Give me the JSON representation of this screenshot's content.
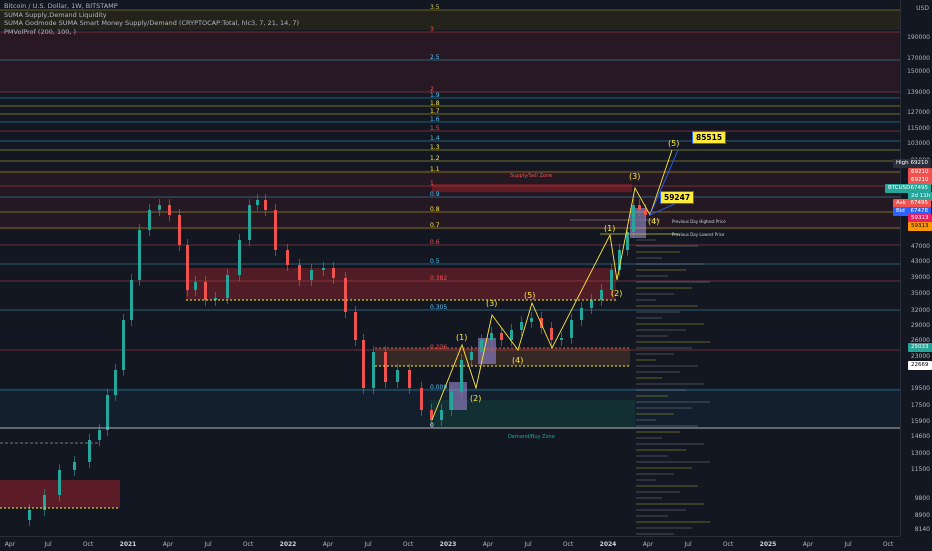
{
  "legend": {
    "symbol": "Bitcoin / U.S. Dollar, 1W, BITSTAMP",
    "indicator_1": "SUMA Supply,Demand Liquidity",
    "indicator_2": "SUMA Godmode SUMA Smart Money Supply/Demand (CRYPTOCAP:Total, hlc3, 7, 21, 14, 7)",
    "indicator_3": "PMVolProf (200, 100, )"
  },
  "price_axis": {
    "currency": "USD",
    "labels": [
      "190000",
      "170000",
      "150000",
      "139000",
      "127000",
      "115000",
      "103000",
      "91000",
      "81000",
      "47000",
      "43000",
      "39000",
      "35000",
      "32000",
      "29000",
      "26000",
      "23000",
      "21000",
      "19500",
      "17500",
      "15900",
      "14600",
      "13000",
      "11500",
      "9800",
      "8900",
      "8140"
    ]
  },
  "price_tags": {
    "high_label": "High",
    "high_value": "69210",
    "tag_69210a": "69210",
    "tag_69210b": "69210",
    "btcusd_label": "BTCUSD",
    "btcusd_value": "67495",
    "countdown": "2d 11h",
    "ask_label": "Ask",
    "ask_value": "67495",
    "bid_label": "Bid",
    "bid_value": "67478",
    "tag_59313a": "59313",
    "tag_59313b": "59313",
    "tag_25033": "25033",
    "tag_22669": "22669"
  },
  "time_axis": {
    "labels": [
      "Apr",
      "Jul",
      "Oct",
      "2021",
      "Apr",
      "Jul",
      "Oct",
      "2022",
      "Apr",
      "Jul",
      "Oct",
      "2023",
      "Apr",
      "Jul",
      "Oct",
      "2024",
      "Apr",
      "Jul",
      "Oct",
      "2025",
      "Apr",
      "Jul",
      "Oct"
    ]
  },
  "fib_levels": [
    "3.5",
    "3",
    "2.5",
    "2",
    "1.9",
    "1.8",
    "1.7",
    "1.6",
    "1.5",
    "1.4",
    "1.3",
    "1.2",
    "1.1",
    "1",
    "0.9",
    "0.8",
    "0.7",
    "0.6",
    "0.5",
    "0.382",
    "0.305",
    "0.236",
    "0.009",
    "0"
  ],
  "zone_labels": {
    "supply": "Supply/Sell Zone",
    "demand": "Demand/Buy Zone",
    "prev_high": "Previous Day Highest Price",
    "prev_low": "Previous Day Lowest Price"
  },
  "waves": {
    "w1a": "(1)",
    "w2a": "(2)",
    "w3a": "(3)",
    "w4a": "(4)",
    "w5a": "(5)",
    "w1b": "(1)",
    "w2b": "(2)",
    "w3b": "(3)",
    "w4b": "(4)",
    "w5b": "(5)"
  },
  "callouts": {
    "target_1": "85515",
    "target_2": "59247"
  },
  "colors": {
    "background": "#131722",
    "bull": "#26a69a",
    "bear": "#ef5350",
    "wave": "#ffeb3b",
    "fib_line": "#c9c24a",
    "supply_zone": "#7a1f2a",
    "demand_zone": "#0f4d3a"
  }
}
